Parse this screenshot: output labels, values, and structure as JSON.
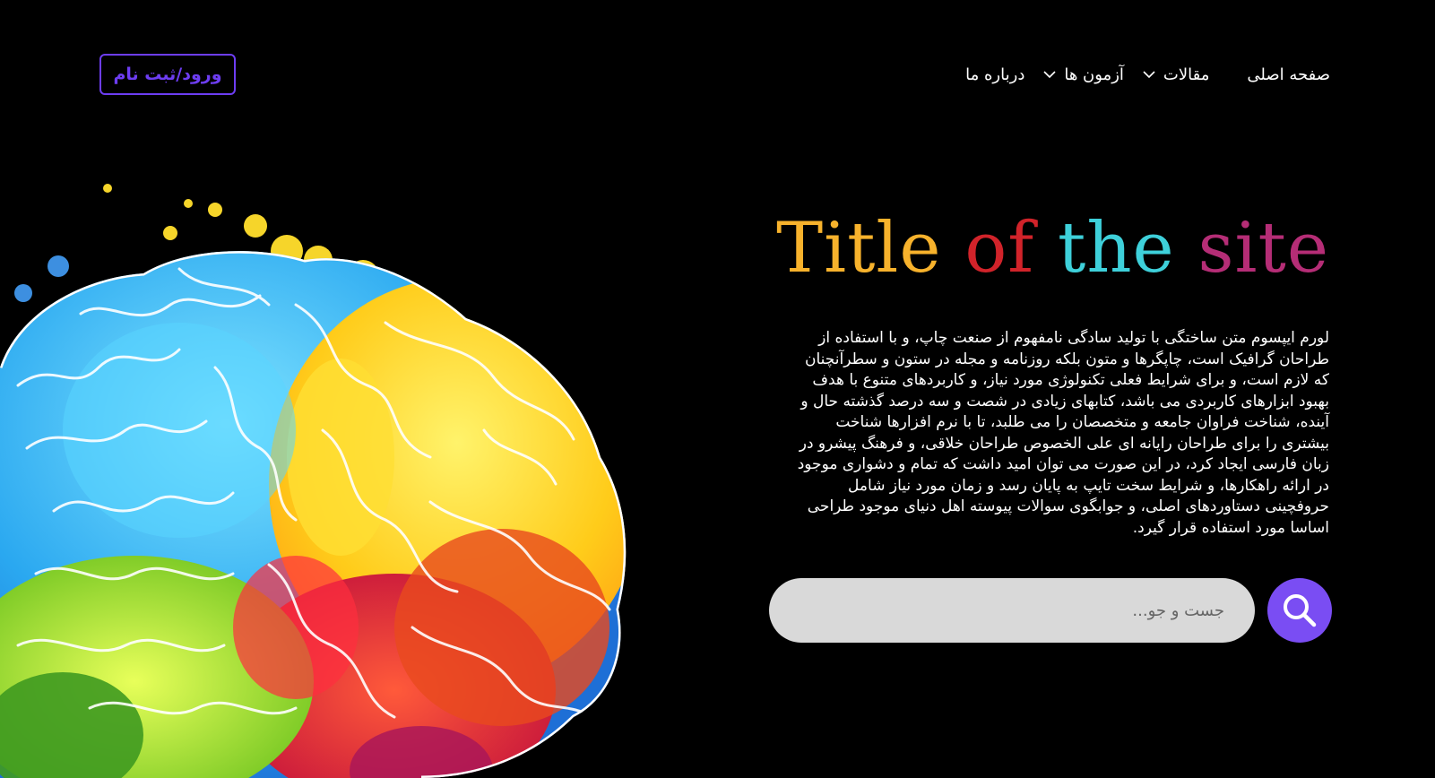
{
  "header": {
    "login_label": "ورود/ثبت نام",
    "nav": {
      "home": "صفحه اصلی",
      "articles": "مقالات",
      "tests": "آزمون ها",
      "about": "درباره ما"
    }
  },
  "hero": {
    "title_words": [
      "Title",
      "of",
      "the",
      "site"
    ],
    "paragraph_lines": [
      "لورم ایپسوم متن ساختگی با تولید سادگی نامفهوم از صنعت چاپ، و با استفاده از",
      "طراحان گرافیک است، چاپگرها و متون بلکه روزنامه و مجله در ستون و سطرآنچنان",
      "که لازم است، و برای شرایط فعلی تکنولوژی مورد نیاز، و کاربردهای متنوع با هدف",
      "بهبود ابزارهای کاربردی می باشد، کتابهای زیادی در شصت و سه درصد گذشته حال و",
      "آینده، شناخت فراوان جامعه و متخصصان را می طلبد، تا با نرم افزارها شناخت",
      "بیشتری را برای طراحان رایانه ای علی الخصوص طراحان خلاقی، و فرهنگ پیشرو در",
      "زبان فارسی ایجاد کرد، در این صورت می توان امید داشت که تمام و دشواری موجود",
      "در ارائه راهکارها، و شرایط سخت تایپ به پایان رسد و زمان مورد نیاز شامل",
      "حروفچینی دستاوردهای اصلی، و جوابگوی سوالات پیوسته اهل دنیای موجود طراحی",
      "اساسا مورد استفاده قرار گیرد."
    ]
  },
  "search": {
    "placeholder": "جست و جو..."
  },
  "colors": {
    "accent": "#7a4df3",
    "title_word_1": "#f7b22c",
    "title_word_2": "#d1232a",
    "title_word_3": "#3ed0da",
    "title_word_4": "#b52d76",
    "search_bg": "#d9d9d9"
  }
}
